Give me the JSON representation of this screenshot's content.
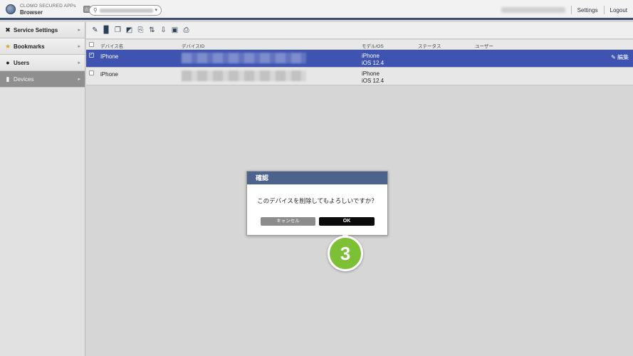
{
  "app": {
    "brand_small": "CLOMO SECURED APPs",
    "brand_big": "Browser"
  },
  "header": {
    "settings_label": "Settings",
    "logout_label": "Logout"
  },
  "sidebar": {
    "items": [
      {
        "label": "Service Settings",
        "icon": "tools-icon"
      },
      {
        "label": "Bookmarks",
        "icon": "star-icon"
      },
      {
        "label": "Users",
        "icon": "user-icon"
      },
      {
        "label": "Devices",
        "icon": "device-icon",
        "active": true
      }
    ]
  },
  "table": {
    "headers": {
      "name": "デバイス名",
      "device_id": "デバイスID",
      "model_os": "モデル/OS",
      "status": "ステータス",
      "user": "ユーザー"
    },
    "rows": [
      {
        "name": "IPhone",
        "model": "iPhone",
        "os": "iOS 12.4",
        "selected": true,
        "edit": "編集"
      },
      {
        "name": "iPhone",
        "model": "iPhone",
        "os": "iOS 12.4",
        "selected": false
      }
    ]
  },
  "dialog": {
    "title": "確認",
    "message": "このデバイスを削除してもよろしいですか？",
    "cancel_label": "キャンセル",
    "ok_label": "OK"
  },
  "step_marker": "3",
  "colors": {
    "header_bar": "#3a4e73",
    "selected_row": "#3f54b0",
    "dialog_title": "#4c638d",
    "marker": "#7ec035"
  }
}
